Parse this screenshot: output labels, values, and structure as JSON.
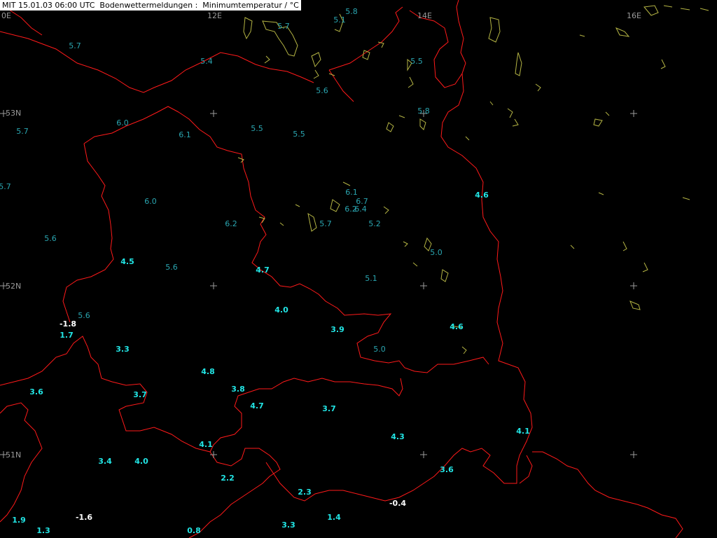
{
  "title": "MIT 15.01.03 06:00 UTC  Bodenwettermeldungen :  Minimumtemperatur / °C",
  "colors": {
    "background": "#000000",
    "border": "#ff1a1a",
    "water": "#b5b544",
    "grid": "#9a9a9a",
    "label_grid": "#9a9a9a",
    "value_bright": "#22e5e5",
    "value_dim": "#2aa5b0",
    "value_negative": "#ffffff"
  },
  "grid_labels": {
    "lon_0": "0E",
    "lon_12": "12E",
    "lon_14": "14E",
    "lon_16": "16E",
    "lat_53": "53N",
    "lat_52": "52N",
    "lat_51": "51N"
  },
  "stations": [
    {
      "v": "5.8",
      "t": "dim"
    },
    {
      "v": "5.1",
      "t": "dim"
    },
    {
      "v": "5.7",
      "t": "dim"
    },
    {
      "v": "5.7",
      "t": "dim"
    },
    {
      "v": "5.4",
      "t": "dim"
    },
    {
      "v": "5.5",
      "t": "dim"
    },
    {
      "v": "5.6",
      "t": "dim"
    },
    {
      "v": "6.0",
      "t": "dim"
    },
    {
      "v": "6.1",
      "t": "dim"
    },
    {
      "v": "5.5",
      "t": "dim"
    },
    {
      "v": "5.5",
      "t": "dim"
    },
    {
      "v": "5.8",
      "t": "dim"
    },
    {
      "v": "5.7",
      "t": "dim"
    },
    {
      "v": "5.7",
      "t": "dim"
    },
    {
      "v": "6.0",
      "t": "dim"
    },
    {
      "v": "6.2",
      "t": "dim"
    },
    {
      "v": "6.1",
      "t": "dim"
    },
    {
      "v": "6.7",
      "t": "dim"
    },
    {
      "v": "6.2",
      "t": "dim"
    },
    {
      "v": "6.4",
      "t": "dim"
    },
    {
      "v": "5.7",
      "t": "dim"
    },
    {
      "v": "5.2",
      "t": "dim"
    },
    {
      "v": "4.6",
      "t": "bright"
    },
    {
      "v": "5.6",
      "t": "dim"
    },
    {
      "v": "4.5",
      "t": "bright"
    },
    {
      "v": "5.6",
      "t": "dim"
    },
    {
      "v": "4.7",
      "t": "bright"
    },
    {
      "v": "5.0",
      "t": "dim"
    },
    {
      "v": "5.1",
      "t": "dim"
    },
    {
      "v": "4.0",
      "t": "bright"
    },
    {
      "v": "5.6",
      "t": "dim"
    },
    {
      "v": "-1.8",
      "t": "neg"
    },
    {
      "v": "1.7",
      "t": "bright"
    },
    {
      "v": "3.9",
      "t": "bright"
    },
    {
      "v": "4.6",
      "t": "bright"
    },
    {
      "v": "5.0",
      "t": "dim"
    },
    {
      "v": "3.3",
      "t": "bright"
    },
    {
      "v": "4.8",
      "t": "bright"
    },
    {
      "v": "3.6",
      "t": "bright"
    },
    {
      "v": "3.8",
      "t": "bright"
    },
    {
      "v": "3.7",
      "t": "bright"
    },
    {
      "v": "4.7",
      "t": "bright"
    },
    {
      "v": "3.7",
      "t": "bright"
    },
    {
      "v": "4.1",
      "t": "bright"
    },
    {
      "v": "4.3",
      "t": "bright"
    },
    {
      "v": "4.1",
      "t": "bright"
    },
    {
      "v": "3.4",
      "t": "bright"
    },
    {
      "v": "4.0",
      "t": "bright"
    },
    {
      "v": "3.6",
      "t": "bright"
    },
    {
      "v": "2.2",
      "t": "bright"
    },
    {
      "v": "2.3",
      "t": "bright"
    },
    {
      "v": "-0.4",
      "t": "neg"
    },
    {
      "v": "1.9",
      "t": "bright"
    },
    {
      "v": "-1.6",
      "t": "neg"
    },
    {
      "v": "1.4",
      "t": "bright"
    },
    {
      "v": "1.3",
      "t": "bright"
    },
    {
      "v": "3.3",
      "t": "bright"
    },
    {
      "v": "0.8",
      "t": "bright"
    }
  ]
}
